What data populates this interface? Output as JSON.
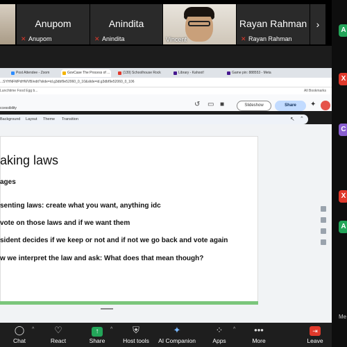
{
  "strip": {
    "participants": [
      {
        "display": "Anupom",
        "label": "Anupom"
      },
      {
        "display": "Anindita",
        "label": "Anindita"
      },
      {
        "video_label": "Vincent"
      },
      {
        "display": "Rayan Rahman",
        "label": "Rayan Rahman"
      }
    ],
    "next_glyph": "›"
  },
  "browser": {
    "tabs": [
      "Post Attendee - Zoom",
      "GovCase The Process of ...",
      "(139) Schoolhouse Rock",
      "Library - Kahoot!",
      "Game pin: 888553 - Meta"
    ],
    "url": "...SYHNFMPdHWVB/edit?slide=id.g3dbf9e52060_0_10&slide=id.g3dbf9e52060_0_106",
    "bookmark": "Lunchtime Food Egg b...",
    "all_bookmarks": "All Bookmarks"
  },
  "slides_app": {
    "menu_fragment": "ccessibility",
    "slideshow_label": "Slideshow",
    "share_label": "Share",
    "toolbar": [
      "Background",
      "Layout",
      "Theme",
      "Transition"
    ]
  },
  "slide": {
    "title": "aking laws",
    "subtitle": "ages",
    "bullets": [
      "senting laws: create what you want, anything idc",
      "vote on those laws and if we want them",
      "sident decides if we keep or not and if not we go back and vote again",
      "w we interpret the law and ask: What does that mean though?"
    ]
  },
  "zoom_toolbar": {
    "items": [
      {
        "label": "Chat",
        "icon": "chat-icon"
      },
      {
        "label": "React",
        "icon": "heart-icon"
      },
      {
        "label": "Share",
        "icon": "share-screen-icon"
      },
      {
        "label": "Host tools",
        "icon": "shield-icon"
      },
      {
        "label": "AI Companion",
        "icon": "sparkle-icon"
      },
      {
        "label": "Apps",
        "icon": "apps-icon"
      },
      {
        "label": "More",
        "icon": "more-icon"
      },
      {
        "label": "Leave",
        "icon": "leave-icon"
      }
    ]
  },
  "side_panel": {
    "badges": [
      "A",
      "X",
      "C",
      "X",
      "A"
    ],
    "tag": "Me"
  },
  "colors": {
    "green": "#23a559",
    "red": "#e0392b",
    "purple": "#8a5fd0",
    "share_btn": "#c2dbff"
  }
}
